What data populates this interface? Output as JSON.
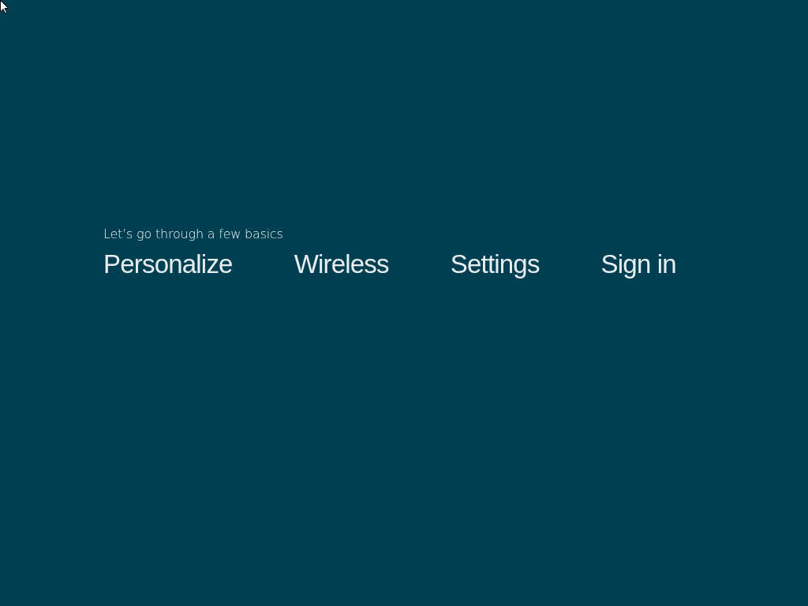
{
  "heading": "Let’s go through a few basics",
  "steps": [
    {
      "label": "Personalize"
    },
    {
      "label": "Wireless"
    },
    {
      "label": "Settings"
    },
    {
      "label": "Sign in"
    }
  ]
}
